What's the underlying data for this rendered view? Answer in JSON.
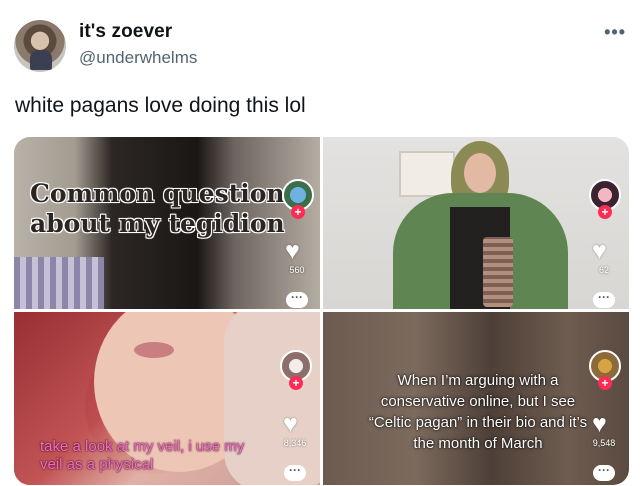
{
  "tweet": {
    "display_name": "it's zoever",
    "handle": "@underwhelms",
    "more_icon": "more-horizontal-icon",
    "text": "white pagans love doing this lol"
  },
  "media": [
    {
      "caption": "Common questions about my tegidion",
      "like_count": "560",
      "caption_color": "#2a2522"
    },
    {
      "caption": "",
      "like_count": "62"
    },
    {
      "caption": "take a look at my veil, i use my veil as a physical",
      "like_count": "8,346",
      "caption_color": "#f06cc4"
    },
    {
      "caption": "When I’m arguing with a conservative online, but I see “Celtic pagan” in their bio and it’s the month of March",
      "like_count": "9,548",
      "caption_color": "#ffffff"
    }
  ],
  "icons": {
    "heart": "heart-icon",
    "follow": "plus-icon",
    "share": "more-dots-icon"
  },
  "colors": {
    "text_primary": "#0f1419",
    "text_secondary": "#536471",
    "follow_badge": "#fe2c55"
  }
}
